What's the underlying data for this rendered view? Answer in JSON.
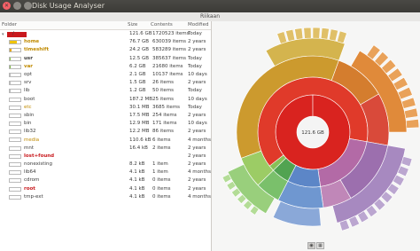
{
  "window": {
    "title": "Disk Usage Analyser"
  },
  "location": {
    "label": "Riikaan"
  },
  "columns": {
    "folder": "Folder",
    "size": "Size",
    "contents": "Contents",
    "modified": "Modified"
  },
  "rows": [
    {
      "name": "/",
      "size": "121.6 GB",
      "contents": "1720523 items",
      "modified": "Today",
      "color": "#c8181c",
      "fill": 1.0,
      "top": true
    },
    {
      "name": "home",
      "size": "76.7 GB",
      "contents": "630039 items",
      "modified": "2 years",
      "color": "#f0c400",
      "fill": 0.63
    },
    {
      "name": "timeshift",
      "size": "24.2 GB",
      "contents": "583289 items",
      "modified": "2 years",
      "color": "#e6a600",
      "fill": 0.2
    },
    {
      "name": "usr",
      "size": "12.5 GB",
      "contents": "385637 items",
      "modified": "Today",
      "color": "#8bc34a",
      "fill": 0.1
    },
    {
      "name": "var",
      "size": "6.2 GB",
      "contents": "21680 items",
      "modified": "Today",
      "color": "#7cb342",
      "fill": 0.05
    },
    {
      "name": "opt",
      "size": "2.1 GB",
      "contents": "10137 items",
      "modified": "10 days",
      "color": "#bbbbbb",
      "fill": 0.02
    },
    {
      "name": "srv",
      "size": "1.5 GB",
      "contents": "26 items",
      "modified": "2 years",
      "color": "#bbbbbb",
      "fill": 0.01
    },
    {
      "name": "lib",
      "size": "1.2 GB",
      "contents": "50 items",
      "modified": "Today",
      "color": "#bbbbbb",
      "fill": 0.01
    },
    {
      "name": "boot",
      "size": "187.2 MB",
      "contents": "25 items",
      "modified": "10 days",
      "color": "#bbbbbb",
      "fill": 0.0
    },
    {
      "name": "etc",
      "size": "30.1 MB",
      "contents": "3685 items",
      "modified": "Today",
      "color": "#bbbbbb",
      "fill": 0.0
    },
    {
      "name": "sbin",
      "size": "17.5 MB",
      "contents": "254 items",
      "modified": "2 years",
      "color": "#bbbbbb",
      "fill": 0.0
    },
    {
      "name": "bin",
      "size": "12.9 MB",
      "contents": "171 items",
      "modified": "10 days",
      "color": "#bbbbbb",
      "fill": 0.0
    },
    {
      "name": "lib32",
      "size": "12.2 MB",
      "contents": "86 items",
      "modified": "2 years",
      "color": "#bbbbbb",
      "fill": 0.0
    },
    {
      "name": "media",
      "size": "110.6 kB",
      "contents": "6 items",
      "modified": "4 months",
      "color": "#bbbbbb",
      "fill": 0.0
    },
    {
      "name": "mnt",
      "size": "16.4 kB",
      "contents": "2 items",
      "modified": "2 years",
      "color": "#bbbbbb",
      "fill": 0.0
    },
    {
      "name": "lost+found",
      "size": "",
      "contents": "",
      "modified": "2 years",
      "color": "#bbbbbb",
      "fill": 0.0
    },
    {
      "name": "nonexisting",
      "size": "8.2 kB",
      "contents": "1 item",
      "modified": "2 years",
      "color": "#bbbbbb",
      "fill": 0.0
    },
    {
      "name": "lib64",
      "size": "4.1 kB",
      "contents": "1 item",
      "modified": "4 months",
      "color": "#bbbbbb",
      "fill": 0.0
    },
    {
      "name": "cdrom",
      "size": "4.1 kB",
      "contents": "0 items",
      "modified": "2 years",
      "color": "#bbbbbb",
      "fill": 0.0
    },
    {
      "name": "root",
      "size": "4.1 kB",
      "contents": "0 items",
      "modified": "2 years",
      "color": "#bbbbbb",
      "fill": 0.0
    },
    {
      "name": "tmp-ext",
      "size": "4.1 kB",
      "contents": "0 items",
      "modified": "4 months",
      "color": "#bbbbbb",
      "fill": 0.0
    }
  ],
  "chart": {
    "center_label": "121.6 GB"
  }
}
